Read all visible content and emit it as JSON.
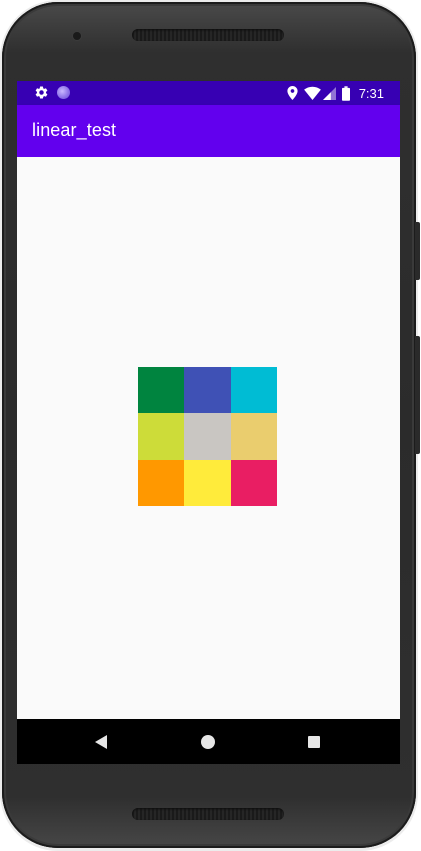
{
  "app": {
    "title": "linear_test"
  },
  "status_bar": {
    "time": "7:31",
    "left_icons": [
      "gear-icon",
      "notification-dot-icon"
    ],
    "right_icons": [
      "location-icon",
      "wifi-icon",
      "cellular-signal-icon",
      "battery-icon"
    ]
  },
  "colors": {
    "status_bar": "#3700b3",
    "app_bar": "#6200ee",
    "background": "#fafafa",
    "nav_bar": "#000000"
  },
  "color_grid": {
    "cells": [
      {
        "color": "#00843f"
      },
      {
        "color": "#3f51b5"
      },
      {
        "color": "#00bcd4"
      },
      {
        "color": "#cddc39"
      },
      {
        "color": "#c9c6c2"
      },
      {
        "color": "#eacd6e"
      },
      {
        "color": "#ff9800"
      },
      {
        "color": "#ffeb3b"
      },
      {
        "color": "#e91e63"
      }
    ]
  },
  "navigation": {
    "buttons": [
      "back-icon",
      "home-icon",
      "recents-icon"
    ]
  }
}
